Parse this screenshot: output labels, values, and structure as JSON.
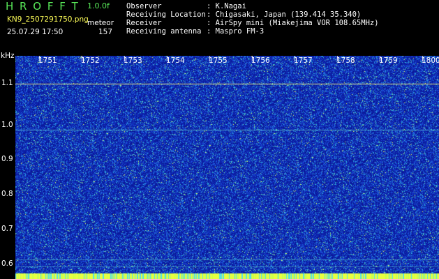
{
  "app": {
    "name": "H R O F F T",
    "version": "1.0.0f",
    "filename": "KN9_2507291750.png",
    "mode": "meteor",
    "datetime": "25.07.29 17:50",
    "count": "157"
  },
  "info": {
    "observer_label": "Observer",
    "observer_value": ": K.Nagai",
    "location_label": "Receiving Location",
    "location_value": ": Chigasaki, Japan (139.414 35.340)",
    "receiver_label": "Receiver",
    "receiver_value": ": AirSpy mini (Miakejima VOR 108.65MHz)",
    "antenna_label": "Receiving antenna",
    "antenna_value": ": Maspro FM-3"
  },
  "axis": {
    "y_unit": "kHz",
    "y_ticks": [
      "1.1",
      "1.0",
      "0.9",
      "0.8",
      "0.7",
      "0.6"
    ],
    "x_ticks": [
      "1751",
      "1752",
      "1753",
      "1754",
      "1755",
      "1756",
      "1757",
      "1758",
      "1759",
      "1800"
    ]
  },
  "colors": {
    "background": "#0d1fa0",
    "noise_mid": "#2050d0",
    "noise_hi": "#30c8d8",
    "noise_peak": "#e8ff60",
    "label_green": "#58e858",
    "label_yellow": "#ffff58"
  }
}
